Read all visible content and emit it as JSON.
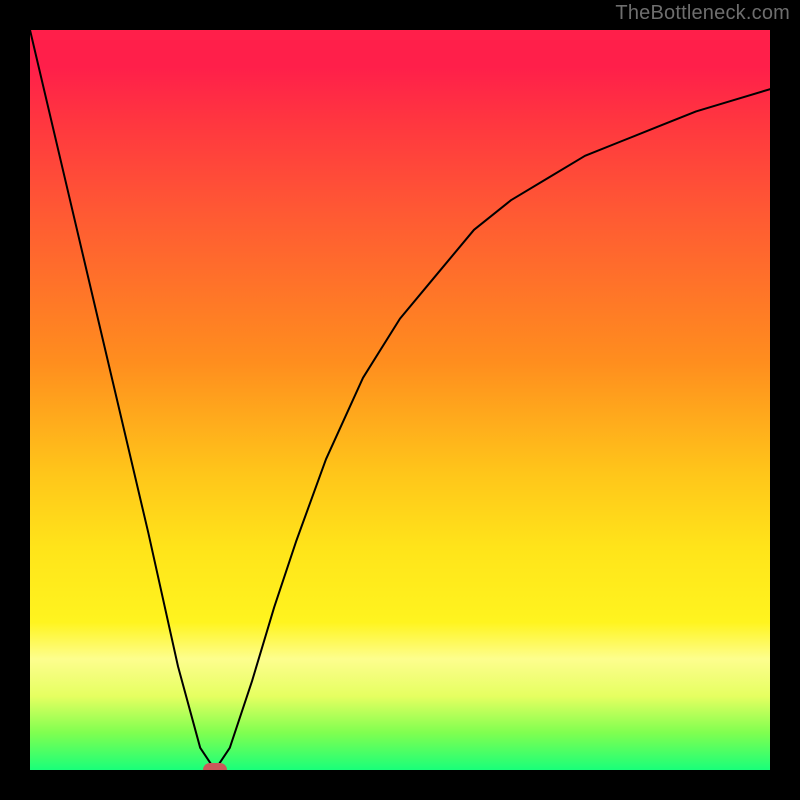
{
  "attribution": "TheBottleneck.com",
  "chart_data": {
    "type": "line",
    "title": "",
    "xlabel": "",
    "ylabel": "",
    "xlim": [
      0,
      100
    ],
    "ylim": [
      0,
      100
    ],
    "series": [
      {
        "name": "curve",
        "x": [
          0,
          4,
          8,
          12,
          16,
          20,
          23,
          25,
          27,
          30,
          33,
          36,
          40,
          45,
          50,
          55,
          60,
          65,
          70,
          75,
          80,
          85,
          90,
          95,
          100
        ],
        "y": [
          100,
          83,
          66,
          49,
          32,
          14,
          3,
          0,
          3,
          12,
          22,
          31,
          42,
          53,
          61,
          67,
          73,
          77,
          80,
          83,
          85,
          87,
          89,
          90.5,
          92
        ]
      }
    ],
    "marker": {
      "x": 25,
      "y": 0
    },
    "gradient_stops": [
      {
        "pct": 0,
        "color": "#ff1f4a"
      },
      {
        "pct": 25,
        "color": "#ff5a33"
      },
      {
        "pct": 60,
        "color": "#ffc61a"
      },
      {
        "pct": 85,
        "color": "#fdfe8e"
      },
      {
        "pct": 100,
        "color": "#19ff7a"
      }
    ]
  }
}
